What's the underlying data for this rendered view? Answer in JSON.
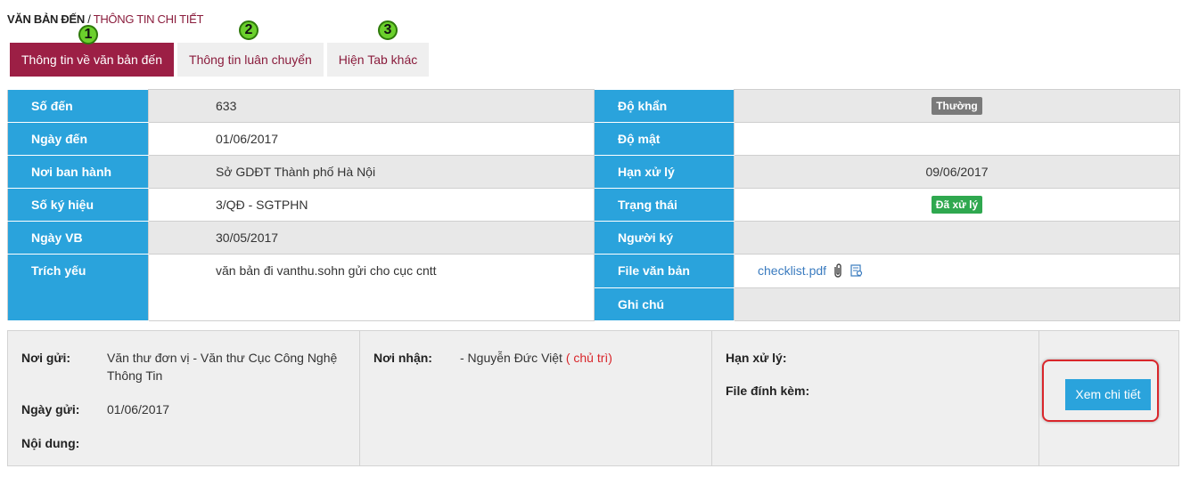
{
  "breadcrumb": {
    "root": "VĂN BẢN ĐẾN",
    "separator": " / ",
    "current": "THÔNG TIN CHI TIẾT"
  },
  "tabs": [
    {
      "label": "Thông tin về văn bản đến",
      "active": true,
      "marker": "1"
    },
    {
      "label": "Thông tin luân chuyển",
      "active": false,
      "marker": "2"
    },
    {
      "label": "Hiện Tab khác",
      "active": false,
      "marker": "3"
    }
  ],
  "details": {
    "left": [
      {
        "label": "Số đến",
        "value": "633"
      },
      {
        "label": "Ngày đến",
        "value": "01/06/2017"
      },
      {
        "label": "Nơi ban hành",
        "value": "Sở GDĐT Thành phố Hà Nội"
      },
      {
        "label": "Số ký hiệu",
        "value": "3/QĐ - SGTPHN"
      },
      {
        "label": "Ngày VB",
        "value": "30/05/2017"
      },
      {
        "label": "Trích yếu",
        "value": "văn bản đi vanthu.sohn gửi cho cục cntt"
      }
    ],
    "right": [
      {
        "label": "Độ khẩn",
        "value": "Thường"
      },
      {
        "label": "Độ mật",
        "value": ""
      },
      {
        "label": "Hạn xử lý",
        "value": "09/06/2017"
      },
      {
        "label": "Trạng thái",
        "value": "Đã xử lý"
      },
      {
        "label": "Người ký",
        "value": ""
      },
      {
        "label": "File văn bản",
        "value": "checklist.pdf"
      },
      {
        "label": "Ghi chú",
        "value": ""
      }
    ]
  },
  "transfer": {
    "sender_label": "Nơi gửi:",
    "sender_value": "Văn thư đơn vị - Văn thư Cục Công Nghệ Thông Tin",
    "sent_date_label": "Ngày gửi:",
    "sent_date_value": "01/06/2017",
    "content_label": "Nội dung:",
    "receiver_label": "Nơi nhận:",
    "receiver_value": "- Nguyễn Đức Việt",
    "receiver_role": "( chủ trì)",
    "deadline_label": "Hạn xử lý:",
    "attachment_label": "File đính kèm:",
    "detail_button": "Xem chi tiết"
  },
  "colors": {
    "brand": "#9c1f45",
    "header_blue": "#2aa3dc",
    "marker_green": "#6bd02c",
    "highlight_red": "#d9262b"
  },
  "icons": [
    "paperclip-icon",
    "view-file-icon"
  ]
}
